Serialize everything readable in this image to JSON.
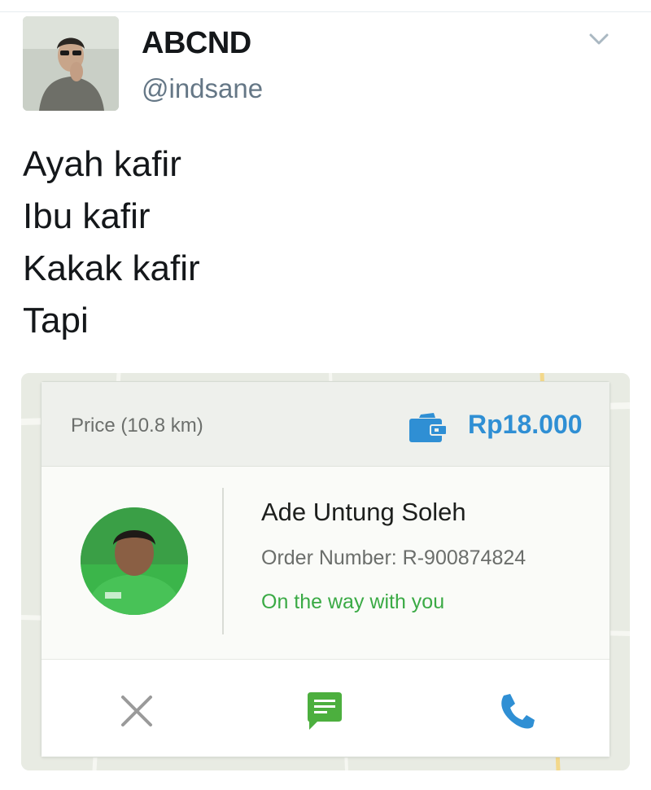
{
  "tweet": {
    "display_name": "ABCND",
    "handle": "@indsane",
    "avatar_icon": "user-avatar-photo",
    "menu_icon": "chevron-down-icon",
    "text_lines": [
      "Ayah kafir",
      "Ibu kafir",
      "Kakak kafir",
      "Tapi"
    ]
  },
  "order_card": {
    "price_label": "Price (10.8 km)",
    "wallet_icon": "wallet-icon",
    "price_value": "Rp18.000",
    "driver_name": "Ade Untung Soleh",
    "order_number": "Order Number: R-900874824",
    "status": "On the way with you",
    "actions": [
      {
        "name": "cancel",
        "icon": "close-icon"
      },
      {
        "name": "chat",
        "icon": "chat-icon"
      },
      {
        "name": "call",
        "icon": "phone-icon"
      }
    ]
  },
  "colors": {
    "price_blue": "#2f8fd4",
    "status_green": "#3aaa45",
    "chat_green": "#4caf3e",
    "handle_gray": "#657786",
    "cancel_gray": "#9a9a9a"
  }
}
